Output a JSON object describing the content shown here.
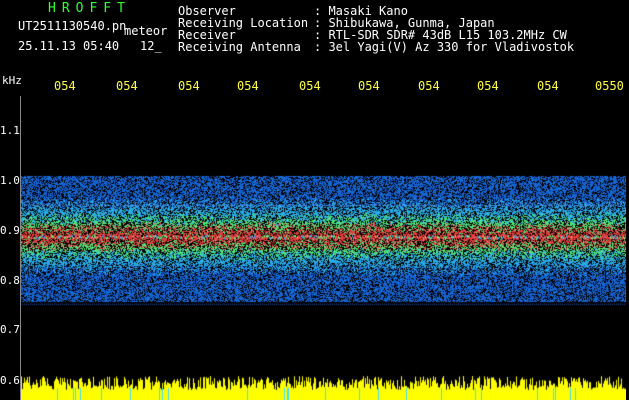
{
  "header": {
    "title": "HROFFT",
    "filename": "UT2511130540.pn",
    "meteor_label": "meteor",
    "datetime": "25.11.13 05:40",
    "index": "12_"
  },
  "info": [
    {
      "label": "Observer",
      "value": ": Masaki Kano"
    },
    {
      "label": "Receiving Location",
      "value": ": Shibukawa, Gunma, Japan"
    },
    {
      "label": "Receiver",
      "value": ": RTL-SDR SDR# 43dB L15 103.2MHz CW"
    },
    {
      "label": "Receiving Antenna",
      "value": ": 3el Yagi(V) Az 330 for Vladivostok"
    }
  ],
  "axis": {
    "unit": "kHz",
    "y_ticks": [
      "1.1",
      "1.0",
      "0.9",
      "0.8",
      "0.7",
      "0.6"
    ],
    "x_ticks": [
      "054",
      "054",
      "054",
      "054",
      "054",
      "054",
      "054",
      "054",
      "054",
      "0550"
    ]
  },
  "spectrogram": {
    "freq_range_khz": [
      0.6,
      1.15
    ],
    "signal_band_khz": [
      0.78,
      1.02
    ],
    "carrier_khz": 0.905,
    "harmonic_khz": 0.965,
    "noise_floor_color": "#ffff00",
    "background_color": "#000000"
  },
  "colors": {
    "title": "#33ff33",
    "time_ticks": "#ffff44",
    "text": "#ffffff"
  }
}
